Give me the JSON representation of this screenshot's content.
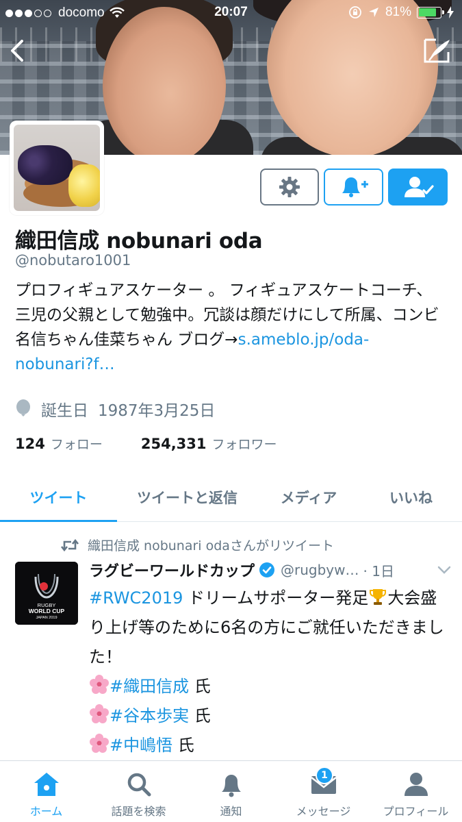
{
  "status_bar": {
    "carrier": "docomo",
    "time": "20:07",
    "battery_text": "81%",
    "battery_level": 0.81
  },
  "profile": {
    "name": "織田信成 nobunari oda",
    "handle": "@nobutaro1001",
    "bio_text": "プロフィギュアスケーター 。 フィギュアスケートコーチ、三児の父親として勉強中。冗談は顔だけにして所属、コンビ名信ちゃん佳菜ちゃん ブログ→",
    "bio_link": "s.ameblo.jp/oda-nobunari?f…",
    "birthday_label": "誕生日",
    "birthday_value": "1987年3月25日",
    "following_count": "124",
    "following_label": "フォロー",
    "followers_count": "254,331",
    "followers_label": "フォロワー"
  },
  "tabs": [
    {
      "label": "ツイート",
      "active": true
    },
    {
      "label": "ツイートと返信",
      "active": false
    },
    {
      "label": "メディア",
      "active": false
    },
    {
      "label": "いいね",
      "active": false
    }
  ],
  "tweet": {
    "retweet_text": "織田信成 nobunari odaさんがリツイート",
    "author": "ラグビーワールドカップ",
    "username": "@rugbyw…",
    "time": "· 1日",
    "avatar_title": "RUGBY",
    "avatar_subtitle": "WORLD CUP",
    "avatar_footer": "JAPAN 2019",
    "line1_tag": "#RWC2019",
    "line1_text": " ドリームサポーター発足",
    "line1_rest": "大会盛り上げ等のために6名の方にご就任いただきました！",
    "names": [
      {
        "tag": "#織田信成",
        "suffix": " 氏"
      },
      {
        "tag": "#谷本歩実",
        "suffix": " 氏"
      },
      {
        "tag": "#中嶋悟",
        "suffix": " 氏"
      }
    ]
  },
  "tab_bar": {
    "items": [
      {
        "label": "ホーム",
        "icon": "home-icon",
        "active": true
      },
      {
        "label": "話題を検索",
        "icon": "search-icon",
        "active": false
      },
      {
        "label": "通知",
        "icon": "bell-icon",
        "active": false
      },
      {
        "label": "メッセージ",
        "icon": "envelope-icon",
        "active": false,
        "badge": "1"
      },
      {
        "label": "プロフィール",
        "icon": "person-icon",
        "active": false
      }
    ]
  },
  "colors": {
    "accent": "#1da1f2",
    "link": "#1b95e0",
    "secondary_text": "#657786"
  }
}
